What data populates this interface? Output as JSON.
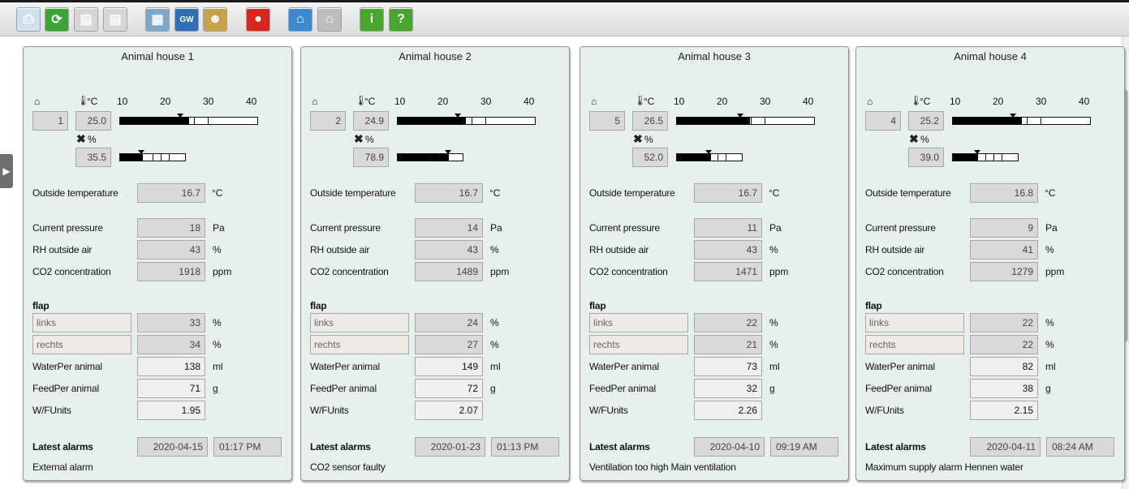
{
  "toolbar": [
    {
      "name": "print-button",
      "glyph": "⎙",
      "bg": "#cfe0ee"
    },
    {
      "name": "refresh-button",
      "glyph": "⟳",
      "bg": "#3aa534"
    },
    {
      "name": "save-button",
      "glyph": "▤",
      "bg": "#d6d6d6"
    },
    {
      "name": "save-as-button",
      "glyph": "▤",
      "bg": "#d6d6d6"
    },
    {
      "name": "settings-button",
      "glyph": "▦",
      "bg": "#7ea7c9"
    },
    {
      "name": "gw-button",
      "glyph": "GW",
      "bg": "#2f6fb8"
    },
    {
      "name": "users-button",
      "glyph": "☻",
      "bg": "#c8a24a"
    },
    {
      "name": "alarm-button",
      "glyph": "●",
      "bg": "#d8261f"
    },
    {
      "name": "home-button",
      "glyph": "⌂",
      "bg": "#3b8ad1"
    },
    {
      "name": "home-disabled-button",
      "glyph": "⌂",
      "bg": "#bdbdbd"
    },
    {
      "name": "info-button",
      "glyph": "i",
      "bg": "#4aa52e"
    },
    {
      "name": "help-button",
      "glyph": "?",
      "bg": "#4aa52e"
    }
  ],
  "labels": {
    "temp_unit": "°C",
    "rh_unit": "%",
    "scale": [
      "10",
      "20",
      "30",
      "40"
    ],
    "outside_temperature": "Outside temperature",
    "current_pressure": "Current pressure",
    "rh_outside_air": "RH outside air",
    "co2_concentration": "CO2 concentration",
    "flap": "flap",
    "water_per_animal": "WaterPer animal",
    "feed_per_animal": "FeedPer animal",
    "wf_units": "W/FUnits",
    "latest_alarms": "Latest alarms",
    "unit_c": "°C",
    "unit_pa": "Pa",
    "unit_pct": "%",
    "unit_ppm": "ppm",
    "unit_ml": "ml",
    "unit_g": "g"
  },
  "houses": [
    {
      "title": "Animal house 1",
      "house_no": "1",
      "temp": "25.0",
      "humidity": "35.5",
      "temp_level": 25.0,
      "temp_setpoint": 22,
      "rh_level": 35.5,
      "rh_setpoint": 33,
      "outside_temp": "16.7",
      "pressure": "18",
      "rh_outside": "43",
      "co2": "1918",
      "flap_links_label": "links",
      "flap_links": "33",
      "flap_rechts_label": "rechts",
      "flap_rechts": "34",
      "water": "138",
      "feed": "71",
      "wf": "1.95",
      "alarm_date": "2020-04-15",
      "alarm_time": "01:17 PM",
      "alarm_text": "External alarm"
    },
    {
      "title": "Animal house 2",
      "house_no": "2",
      "temp": "24.9",
      "humidity": "78.9",
      "temp_level": 24.9,
      "temp_setpoint": 22,
      "rh_level": 78.9,
      "rh_setpoint": 78,
      "outside_temp": "16.7",
      "pressure": "14",
      "rh_outside": "43",
      "co2": "1489",
      "flap_links_label": "links",
      "flap_links": "24",
      "flap_rechts_label": "rechts",
      "flap_rechts": "27",
      "water": "149",
      "feed": "72",
      "wf": "2.07",
      "alarm_date": "2020-01-23",
      "alarm_time": "01:13 PM",
      "alarm_text": "CO2 sensor faulty"
    },
    {
      "title": "Animal house 3",
      "house_no": "5",
      "temp": "26.5",
      "humidity": "52.0",
      "temp_level": 26.5,
      "temp_setpoint": 23,
      "rh_level": 52.0,
      "rh_setpoint": 49,
      "outside_temp": "16.7",
      "pressure": "11",
      "rh_outside": "43",
      "co2": "1471",
      "flap_links_label": "links",
      "flap_links": "22",
      "flap_rechts_label": "rechts",
      "flap_rechts": "21",
      "water": "73",
      "feed": "32",
      "wf": "2.26",
      "alarm_date": "2020-04-10",
      "alarm_time": "09:19 AM",
      "alarm_text": "Ventilation too high Main ventilation"
    },
    {
      "title": "Animal house 4",
      "house_no": "4",
      "temp": "25.2",
      "humidity": "39.0",
      "temp_level": 25.2,
      "temp_setpoint": 22,
      "rh_level": 39.0,
      "rh_setpoint": 38,
      "outside_temp": "16.8",
      "pressure": "9",
      "rh_outside": "41",
      "co2": "1279",
      "flap_links_label": "links",
      "flap_links": "22",
      "flap_rechts_label": "rechts",
      "flap_rechts": "22",
      "water": "82",
      "feed": "38",
      "wf": "2.15",
      "alarm_date": "2020-04-11",
      "alarm_time": "08:24 AM",
      "alarm_text": "Maximum supply alarm Hennen water"
    }
  ]
}
